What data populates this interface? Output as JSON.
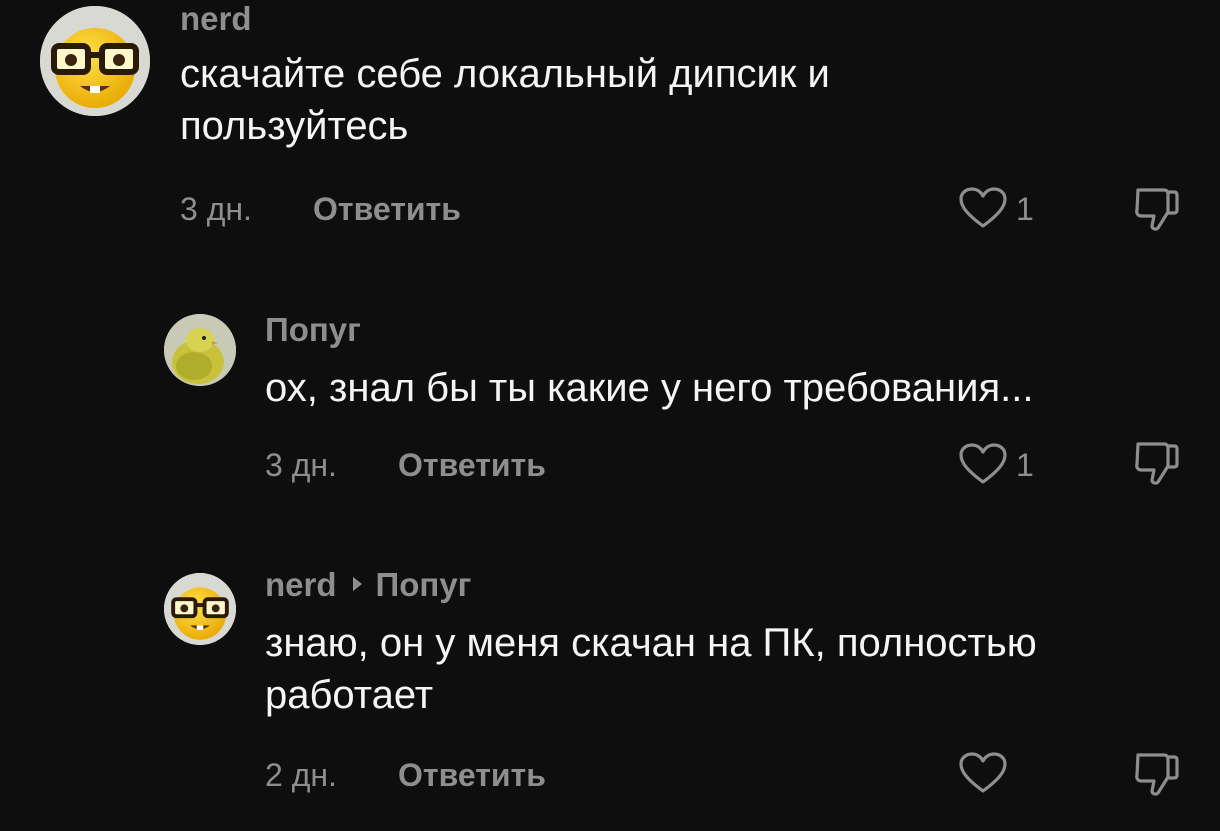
{
  "comments": [
    {
      "username": "nerd",
      "reply_to": "",
      "text_line1": "скачайте себе локальный дипсик и",
      "text_line2": "пользуйтесь",
      "time": "3 дн.",
      "reply_label": "Ответить",
      "like_count": "1",
      "avatar_icon": "nerd-face-emoji"
    },
    {
      "username": "Попуг",
      "reply_to": "",
      "text_line1": "ох, знал бы ты какие у него требования...",
      "text_line2": "",
      "time": "3 дн.",
      "reply_label": "Ответить",
      "like_count": "1",
      "avatar_icon": "bird-photo"
    },
    {
      "username": "nerd",
      "reply_to": "Попуг",
      "text_line1": "знаю, он у меня скачан на ПК, полностью",
      "text_line2": "работает",
      "time": "2 дн.",
      "reply_label": "Ответить",
      "like_count": "",
      "avatar_icon": "nerd-face-emoji"
    }
  ],
  "icons": {
    "like": "heart-outline-icon",
    "dislike": "thumbs-down-outline-icon",
    "reply_arrow": "caret-right-icon"
  },
  "colors": {
    "background": "#0e0e0e",
    "text": "#f5f5f5",
    "muted": "#8e8e8e"
  }
}
